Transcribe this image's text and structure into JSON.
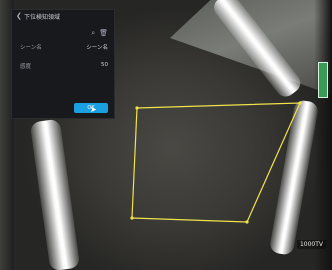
{
  "panel": {
    "title": "下位検知領域",
    "row1_label": "シーン名",
    "row1_value": "シーン名",
    "row2_label": "感度",
    "row2_value": "50",
    "button_label": "OK"
  },
  "overlay": {
    "watermark": "1000TV",
    "region_color": "#f2e24c"
  }
}
